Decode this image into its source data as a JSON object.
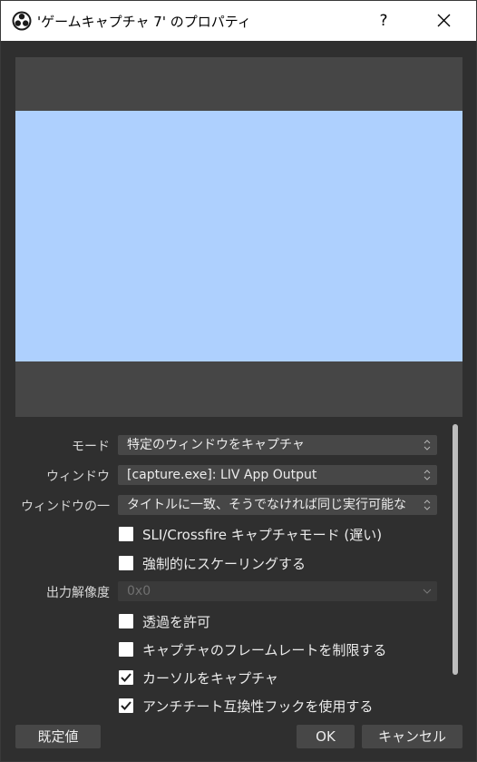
{
  "window": {
    "title": "'ゲームキャプチャ 7' のプロパティ",
    "help_label": "?",
    "icons": {
      "app": "obs-logo-icon",
      "close": "close-icon"
    }
  },
  "properties": {
    "mode": {
      "label": "モード",
      "value": "特定のウィンドウをキャプチャ"
    },
    "window": {
      "label": "ウィンドウ",
      "value": "[capture.exe]: LIV App Output"
    },
    "window_match": {
      "label": "ウィンドウの一",
      "value": "タイトルに一致、そうでなければ同じ実行可能な"
    },
    "sli": {
      "label": "SLI/Crossfire キャプチャモード (遅い)",
      "checked": false
    },
    "force_scaling": {
      "label": "強制的にスケーリングする",
      "checked": false
    },
    "output_resolution": {
      "label": "出力解像度",
      "value": "0x0",
      "enabled": false
    },
    "allow_transparency": {
      "label": "透過を許可",
      "checked": false
    },
    "limit_framerate": {
      "label": "キャプチャのフレームレートを制限する",
      "checked": false
    },
    "capture_cursor": {
      "label": "カーソルをキャプチャ",
      "checked": true
    },
    "anticheat_hook": {
      "label": "アンチチート互換性フックを使用する",
      "checked": true
    }
  },
  "buttons": {
    "defaults": "既定値",
    "ok": "OK",
    "cancel": "キャンセル"
  },
  "colors": {
    "preview_background": "#464646",
    "capture_area": "#aed0fe",
    "dialog_background": "#2f2f2f"
  }
}
